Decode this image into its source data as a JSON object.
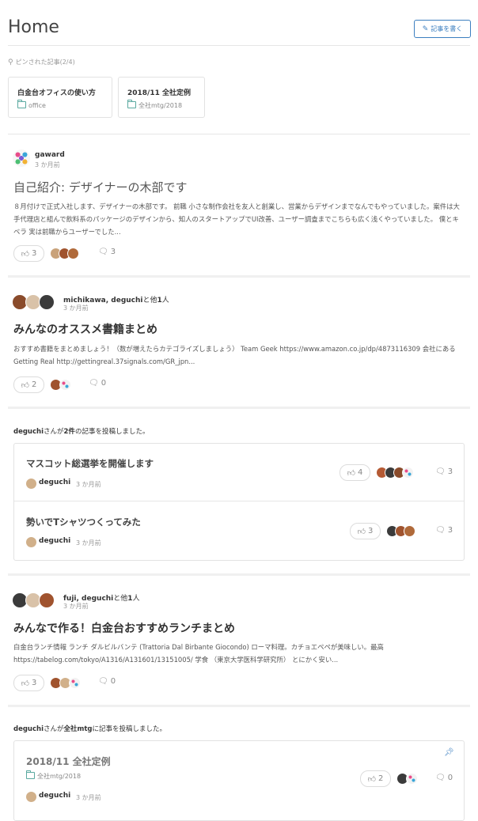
{
  "header": {
    "title": "Home",
    "write_button": "記事を書く"
  },
  "pinned": {
    "label": "ピンされた記事(2/4)",
    "cards": [
      {
        "title": "白金台オフィスの使い方",
        "folder": "office"
      },
      {
        "title": "2018/11 全社定例",
        "folder": "全社mtg/2018"
      }
    ]
  },
  "posts": [
    {
      "author": "gaward",
      "time": "3 か月前",
      "title": "自己紹介: デザイナーの木部です",
      "excerpt": "８月付けで正式入社します、デザイナーの木部です。 前職 小さな制作会社を友人と創業し、営業からデザインまでなんでもやっていました。案件は大手代理店と組んで飲料系のパッケージのデザインから、知人のスタートアップでUI改善、ユーザー調査までこちらも広く浅くやっていました。 僕とキベラ 実は前職からユーザーでした...",
      "likes": "3",
      "comments": "3"
    },
    {
      "author_names": "michikawa, deguchi",
      "author_suffix": "と他",
      "author_count": "1",
      "author_suffix2": "人",
      "time": "3 か月前",
      "title": "みんなのオススメ書籍まとめ",
      "excerpt": "おすすめ書籍をまとめましょう！（数が増えたらカテゴライズしましょう） Team Geek https://www.amazon.co.jp/dp/4873116309 会社にある Getting Real http://gettingreal.37signals.com/GR_jpn...",
      "likes": "2",
      "comments": "0"
    }
  ],
  "activity1": {
    "user": "deguchi",
    "text1": "さんが",
    "count": "2件",
    "text2": "の記事を投稿しました。",
    "items": [
      {
        "title": "マスコット総選挙を開催します",
        "author": "deguchi",
        "time": "3 か月前",
        "likes": "4",
        "comments": "3"
      },
      {
        "title": "勢いでTシャツつくってみた",
        "author": "deguchi",
        "time": "3 か月前",
        "likes": "3",
        "comments": "3"
      }
    ]
  },
  "post3": {
    "author_names": "fuji, deguchi",
    "author_suffix": "と他",
    "author_count": "1",
    "author_suffix2": "人",
    "time": "3 か月前",
    "title": "みんなで作る！白金台おすすめランチまとめ",
    "excerpt": "白金台ランチ情報 ランチ ダルビルバンテ (Trattoria Dal Birbante Giocondo) ローマ料理。カチョエペペが美味しい。最高 https://tabelog.com/tokyo/A1316/A131601/13151005/ 学食 （東京大学医科学研究所） とにかく安い...",
    "likes": "3",
    "comments": "0"
  },
  "activity2": {
    "user": "deguchi",
    "text1": "さんが",
    "group": "全社mtg",
    "text2": "に記事を投稿しました。",
    "item": {
      "title": "2018/11 全社定例",
      "folder": "全社mtg/2018",
      "author": "deguchi",
      "time": "3 か月前",
      "likes": "2",
      "comments": "0"
    }
  }
}
